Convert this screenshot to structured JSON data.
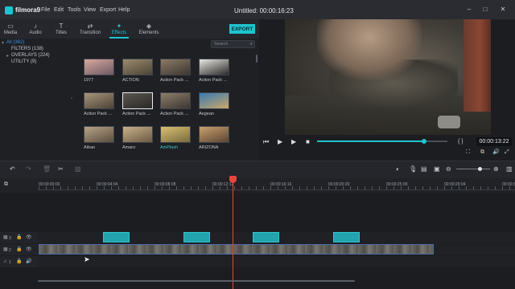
{
  "app": {
    "logo_text": "filmora9",
    "title": "Untitled: 00:00:16:23"
  },
  "menu": [
    "File",
    "Edit",
    "Tools",
    "View",
    "Export",
    "Help"
  ],
  "window_controls": [
    "–",
    "□",
    "✕"
  ],
  "tabs": [
    {
      "label": "Media",
      "icon": "folder-icon",
      "glyph": "▭"
    },
    {
      "label": "Audio",
      "icon": "music-note-icon",
      "glyph": "♪"
    },
    {
      "label": "Titles",
      "icon": "text-icon",
      "glyph": "T"
    },
    {
      "label": "Transition",
      "icon": "transition-icon",
      "glyph": "⇄"
    },
    {
      "label": "Effects",
      "icon": "effects-icon",
      "glyph": "✦"
    },
    {
      "label": "Elements",
      "icon": "elements-icon",
      "glyph": "◈"
    }
  ],
  "active_tab": "Effects",
  "export_label": "EXPORT",
  "categories": [
    {
      "label": "All (362)",
      "selected": true
    },
    {
      "label": "FILTERS (138)",
      "selected": false
    },
    {
      "label": "OVERLAYS (224)",
      "selected": false
    },
    {
      "label": "UTILITY (9)",
      "selected": false
    }
  ],
  "search": {
    "placeholder": "Search",
    "value": ""
  },
  "effects": [
    {
      "label": "1977",
      "colors": [
        "#d9a89c",
        "#6b5a66"
      ]
    },
    {
      "label": "ACTION",
      "colors": [
        "#9c8a6e",
        "#4a4436"
      ]
    },
    {
      "label": "Action Pack ...",
      "colors": [
        "#8c7a66",
        "#3c3630"
      ]
    },
    {
      "label": "Action Pack ...",
      "colors": [
        "#e9e6e0",
        "#2a2a2a"
      ]
    },
    {
      "label": "Action Pack ...",
      "colors": [
        "#a8957c",
        "#4c4236"
      ]
    },
    {
      "label": "Action Pack ...",
      "colors": [
        "#5a5550",
        "#2a2826"
      ]
    },
    {
      "label": "Action Pack ...",
      "colors": [
        "#8e7e6a",
        "#3c3630"
      ]
    },
    {
      "label": "Aegean",
      "colors": [
        "#3a7ab0",
        "#c9a86a"
      ]
    },
    {
      "label": "Aibao",
      "colors": [
        "#b8a286",
        "#5a4e40"
      ]
    },
    {
      "label": "Amaro",
      "colors": [
        "#c8b08a",
        "#6a5a44"
      ]
    },
    {
      "label": "AmPlash",
      "colors": [
        "#d8c070",
        "#7a6a40"
      ]
    },
    {
      "label": "ARIZONA",
      "colors": [
        "#c9a070",
        "#5a4530"
      ]
    }
  ],
  "selected_effect": "Action Pack ...",
  "accent_effect": "AmPlash",
  "player": {
    "timecode": "00:00:13:22",
    "progress": 0.82,
    "controls": {
      "prev": "⏮",
      "play_slow": "▶",
      "play": "▶",
      "stop": "■"
    },
    "bracket": "{ }",
    "right_icons": [
      "⛶",
      "⧉",
      "🔊",
      "⤢"
    ]
  },
  "timeline": {
    "toolbar_left": [
      "↶",
      "↷",
      "🗑",
      "✂",
      "▧"
    ],
    "toolbar_right": [
      "◐",
      "🎙",
      "▤",
      "▣",
      "⊖",
      "⊕",
      "▥"
    ],
    "zoom": 0.7,
    "ruler": [
      "00:00:00:00",
      "00:00:04:04",
      "00:00:08:08",
      "00:00:12:12",
      "00:00:16:16",
      "00:00:20:20",
      "00:00:25:00",
      "00:00:29:04",
      "00:00:33:08"
    ],
    "ruler_start_seconds": 0,
    "ruler_end_seconds": 33.33,
    "playhead_seconds": 13.92,
    "tracks": [
      {
        "number": "3",
        "glyphs": [
          "▦",
          "🔒",
          "👁"
        ]
      },
      {
        "number": "2",
        "glyphs": [
          "▦",
          "🔒",
          "👁"
        ]
      },
      {
        "number": "1",
        "glyphs": [
          "♫",
          "🔒",
          "🔊"
        ]
      }
    ],
    "overlay_clip_starts_seconds": [
      4.64,
      10.4,
      15.4,
      21.2
    ],
    "overlay_clip_length_seconds": 1.9,
    "video_clip_seconds": [
      0,
      28.4
    ]
  },
  "colors": {
    "accent": "#1fc4cf",
    "playhead": "#e8463a",
    "selected_category": "#3b8fe0"
  }
}
